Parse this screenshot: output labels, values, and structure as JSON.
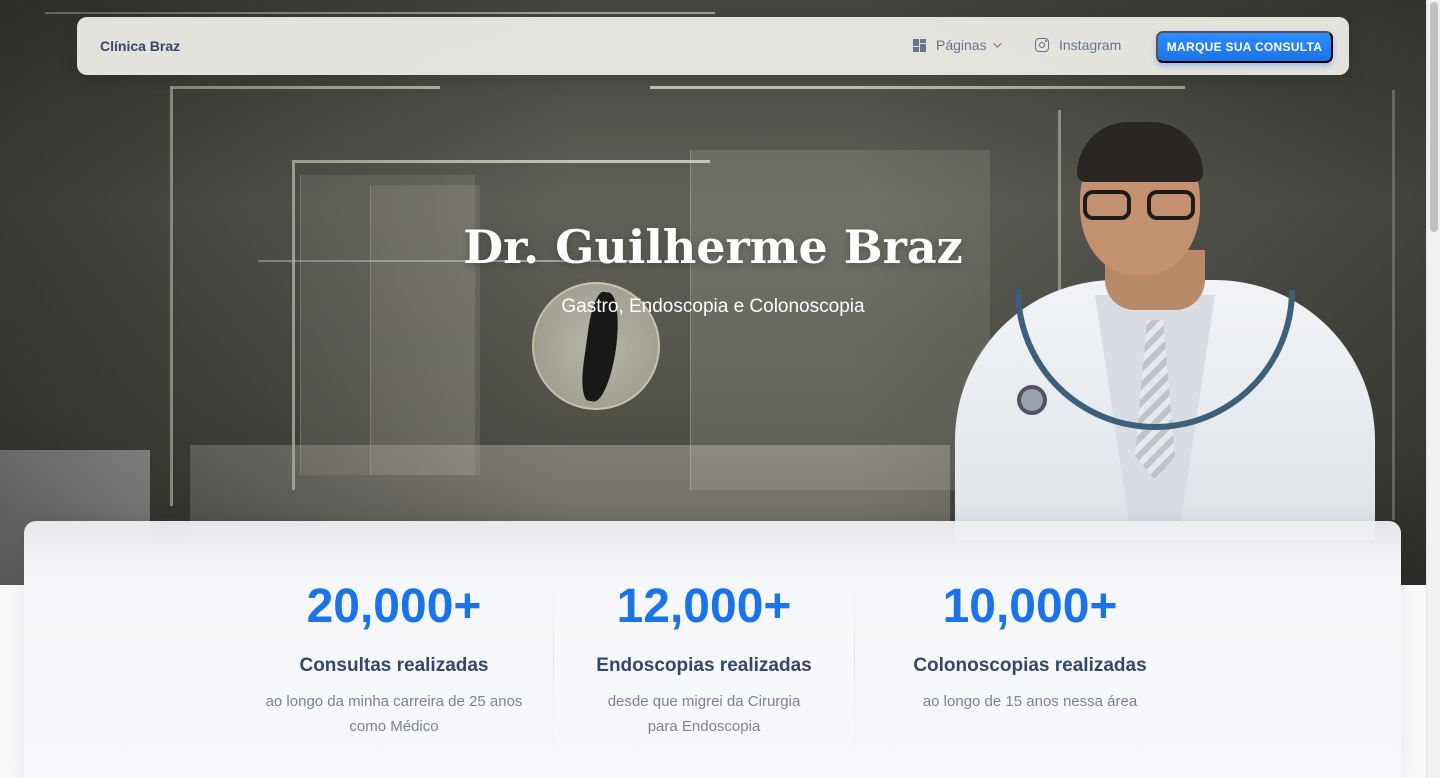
{
  "navbar": {
    "brand": "Clínica Braz",
    "links": [
      {
        "label": "Páginas",
        "icon": "grid-icon",
        "has_dropdown": true
      },
      {
        "label": "Instagram",
        "icon": "instagram-icon"
      }
    ],
    "cta_label": "MARQUE SUA CONSULTA"
  },
  "hero": {
    "title": "Dr. Guilherme Braz",
    "subtitle": "Gastro, Endoscopia e Colonoscopia"
  },
  "stats": [
    {
      "value": "20,000+",
      "label": "Consultas realizadas",
      "description": "ao longo da minha carreira de 25 anos como Médico"
    },
    {
      "value": "12,000+",
      "label": "Endoscopias realizadas",
      "description": "desde que migrei da Cirurgia para Endoscopia"
    },
    {
      "value": "10,000+",
      "label": "Colonoscopias realizadas",
      "description": "ao longo de 15 anos nessa área"
    }
  ],
  "colors": {
    "accent": "#1a73e8",
    "heading": "#344767",
    "muted": "#7b809a"
  }
}
